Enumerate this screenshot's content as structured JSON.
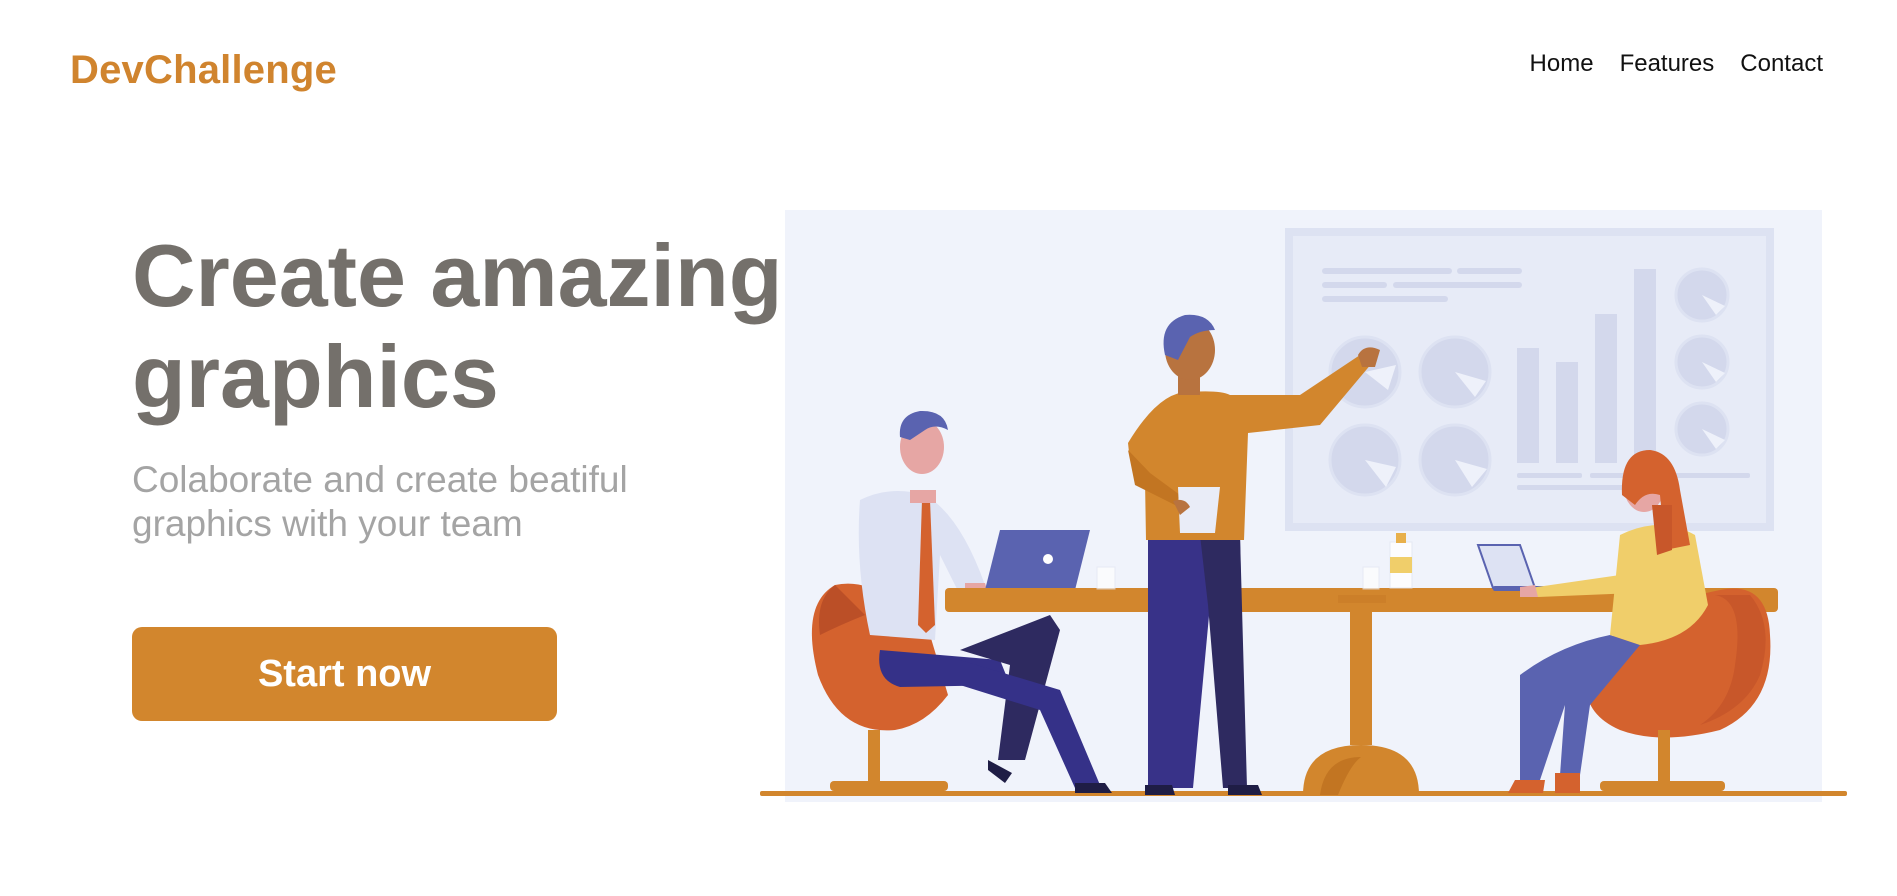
{
  "header": {
    "logo": "DevChallenge",
    "nav": [
      {
        "label": "Home"
      },
      {
        "label": "Features"
      },
      {
        "label": "Contact"
      }
    ]
  },
  "hero": {
    "title_line1": "Create amazing",
    "title_line2": "graphics",
    "subtitle_line1": "Colaborate and create beatiful",
    "subtitle_line2": "graphics with your team",
    "cta_label": "Start now"
  },
  "colors": {
    "brand": "#d0842e",
    "button": "#d2862d",
    "title": "#74706b",
    "subtitle": "#a4a4a4",
    "illustration_bg": "#f0f3fb"
  }
}
